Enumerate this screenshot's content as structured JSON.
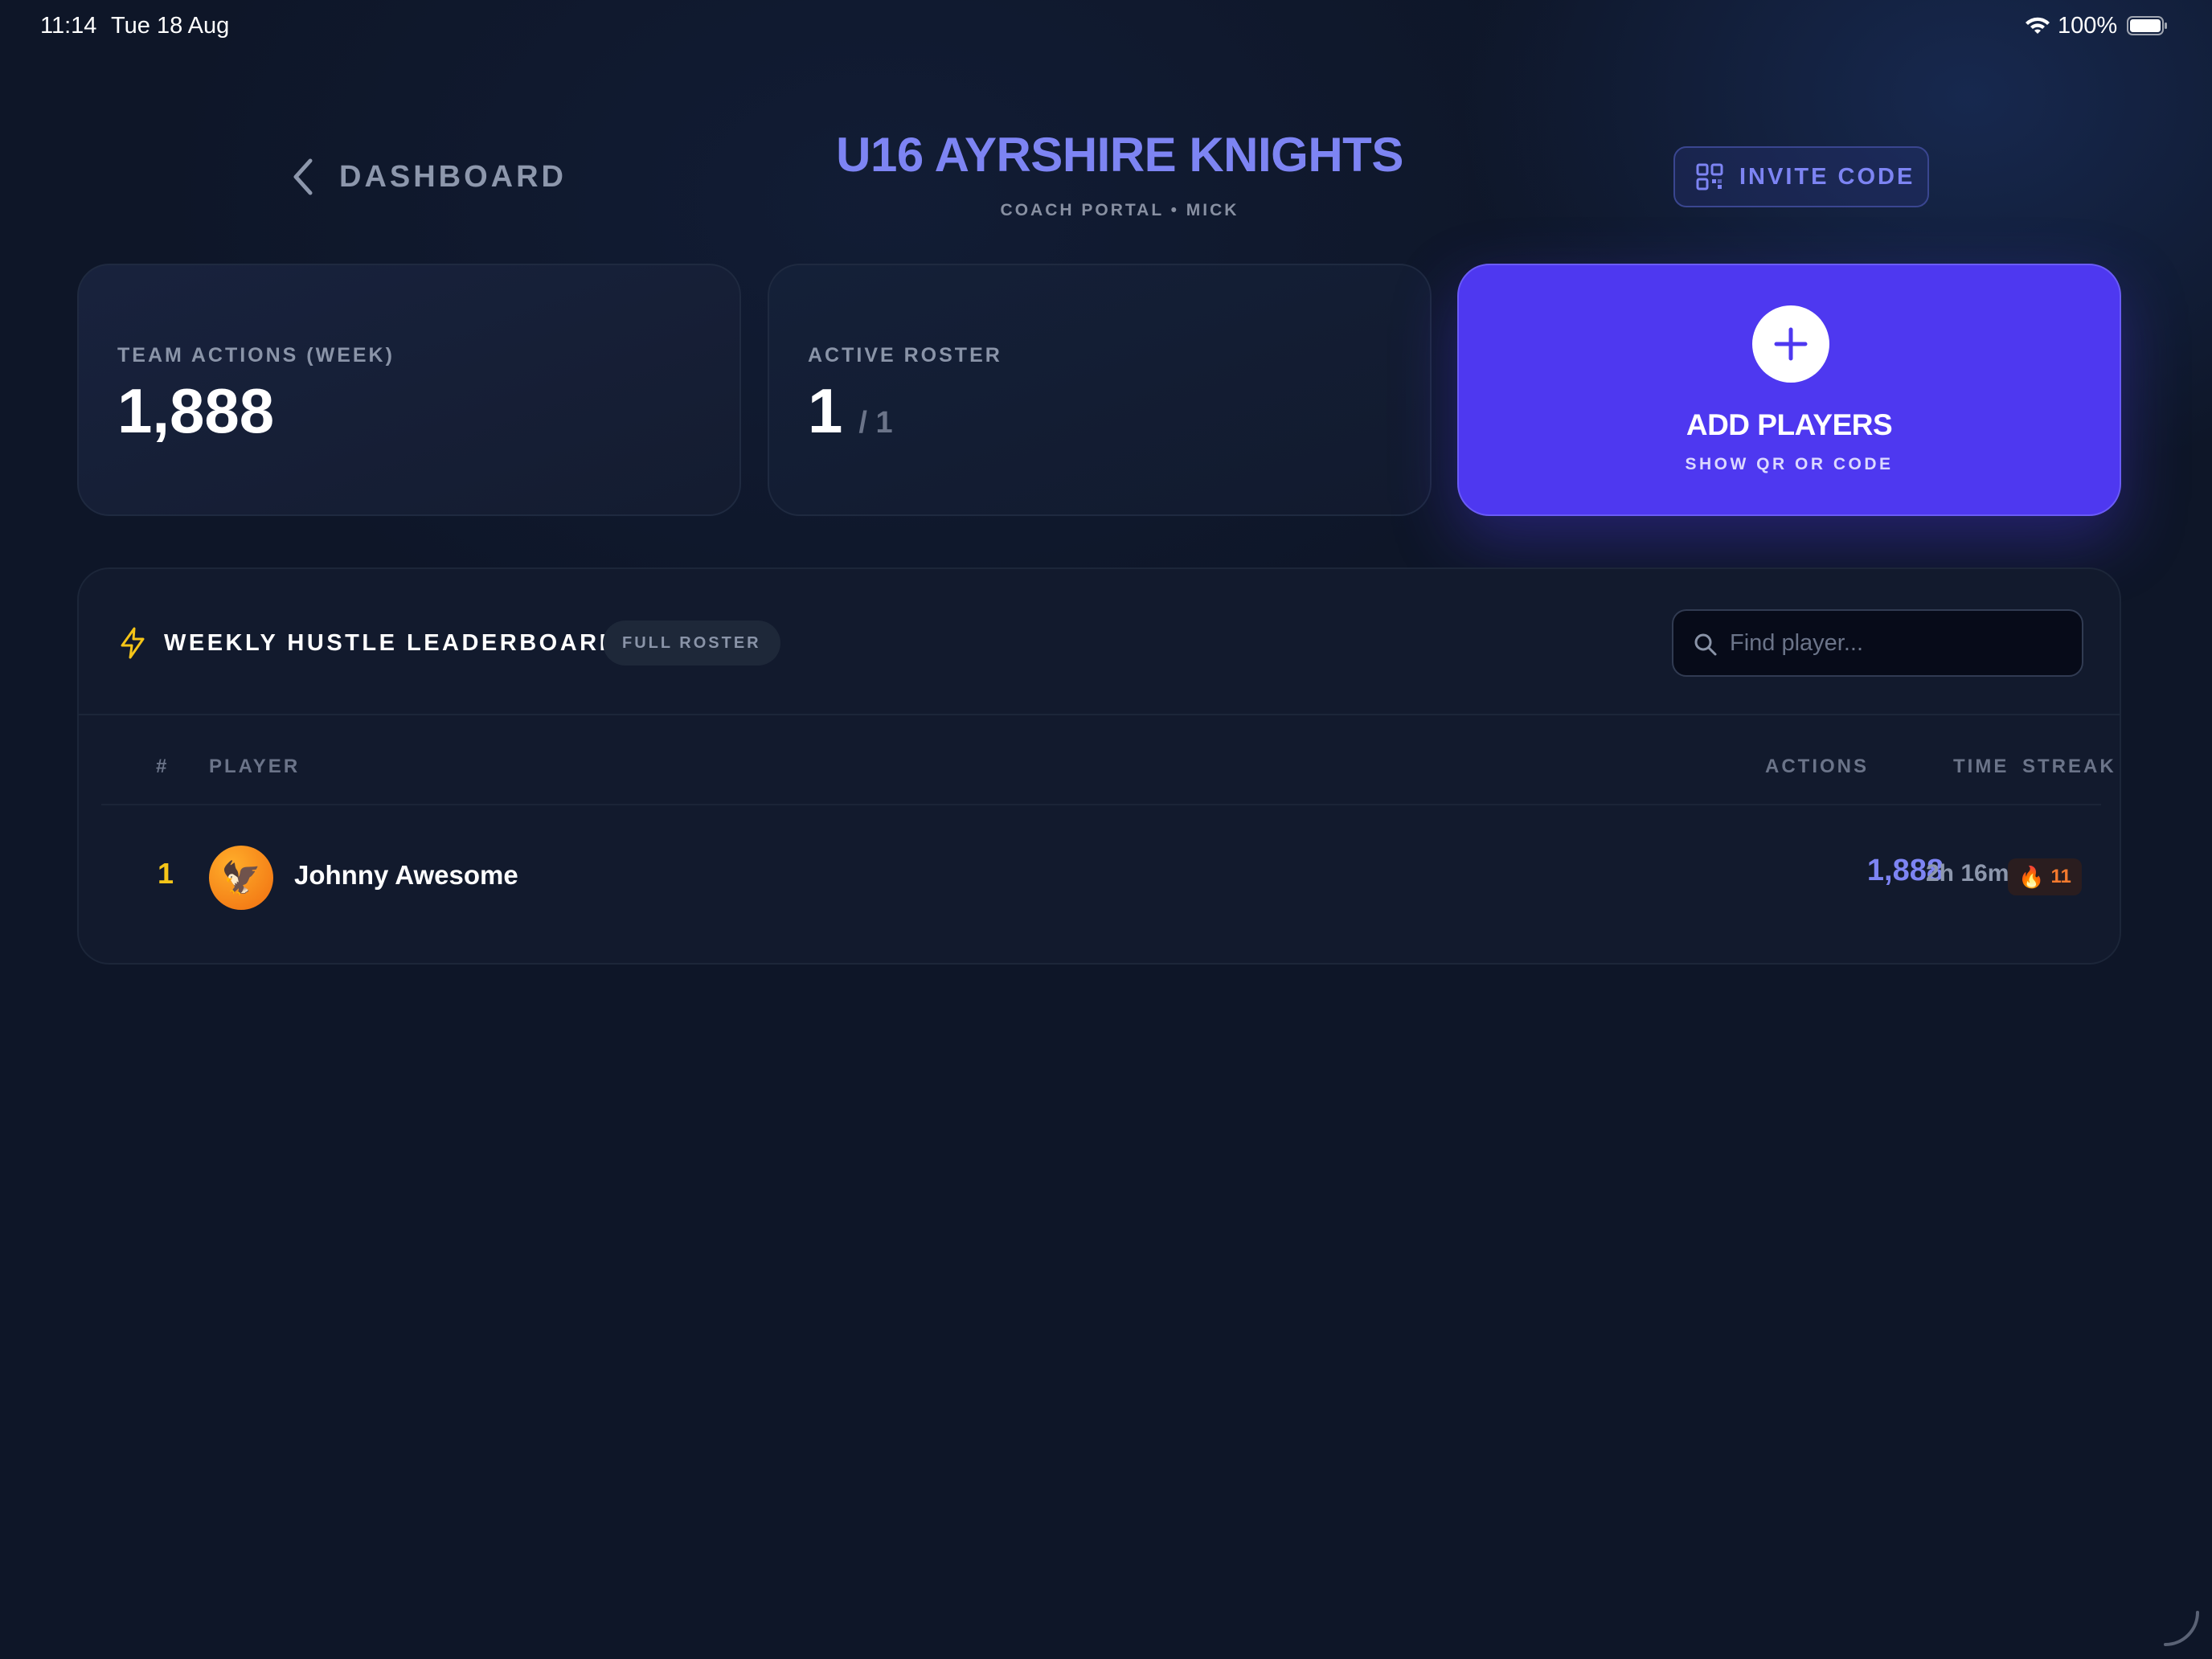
{
  "status_bar": {
    "time": "11:14",
    "date": "Tue 18 Aug",
    "battery_percent": "100%",
    "icons": [
      "wifi-icon",
      "battery-icon"
    ]
  },
  "header": {
    "back_label": "DASHBOARD",
    "title": "U16 AYRSHIRE KNIGHTS",
    "subtitle": "COACH PORTAL • MICK",
    "invite_label": "INVITE CODE",
    "icons": [
      "chevron-left-icon",
      "qr-code-icon"
    ]
  },
  "stats": {
    "team_actions": {
      "label": "TEAM ACTIONS (WEEK)",
      "value": "1,888"
    },
    "active_roster": {
      "label": "ACTIVE ROSTER",
      "value": "1",
      "total": "/ 1"
    }
  },
  "add_players": {
    "title": "ADD PLAYERS",
    "subtitle": "SHOW QR OR CODE",
    "icon": "plus-icon"
  },
  "leaderboard": {
    "title": "WEEKLY HUSTLE LEADERBOARD",
    "badge": "FULL ROSTER",
    "search_placeholder": "Find player...",
    "search_value": "",
    "columns": {
      "rank": "#",
      "player": "PLAYER",
      "actions": "ACTIONS",
      "time": "TIME",
      "streak": "STREAK"
    },
    "rows": [
      {
        "rank": "1",
        "avatar": "🦅",
        "name": "Johnny Awesome",
        "actions": "1,888",
        "time": "2h 16m",
        "streak_icon": "🔥",
        "streak": "11"
      }
    ]
  },
  "colors": {
    "background": "#0e1628",
    "accent": "#7d84f3",
    "primary_button": "#4e38f0",
    "rank_gold": "#f5c518",
    "streak_orange": "#f57a2e"
  }
}
